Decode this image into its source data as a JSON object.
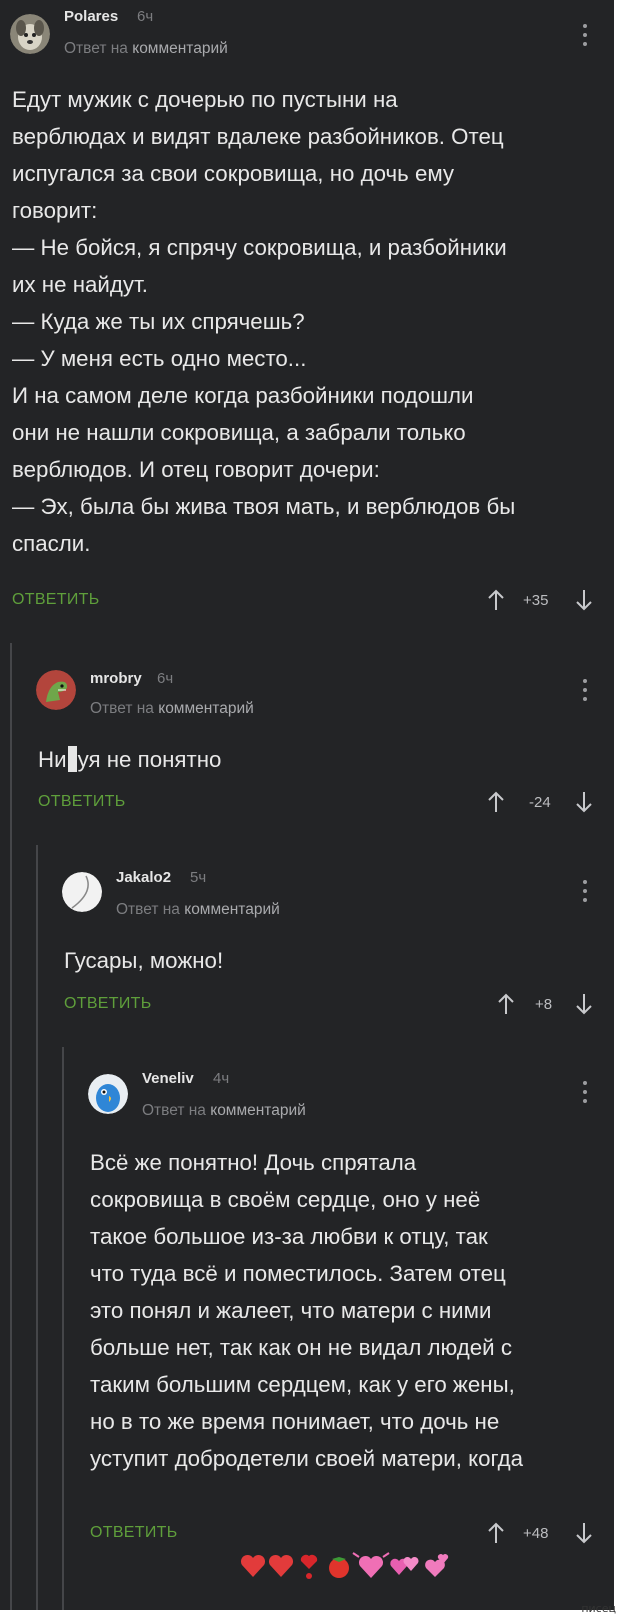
{
  "colors": {
    "background": "#232426",
    "accent_reply": "#5f9f3b",
    "text": "#e8e8e8",
    "muted": "#7c7d80"
  },
  "comments": [
    {
      "username": "Polares",
      "time": "6ч",
      "reply_prefix": "Ответ на",
      "reply_target": "комментарий",
      "avatar_icon": "dog-avatar-icon",
      "text": "Едут мужик с дочерью по пустыни на\nверблюдах и видят вдалеке разбойников. Отец\nиспугался за свои сокровища, но дочь ему\nговорит:\n— Не бойся, я спрячу сокровища, и разбойники\nих не найдут.\n— Куда же ты их спрячешь?\n— У меня есть одно место...\nИ на самом деле когда разбойники подошли\nони не нашли сокровища, а забрали только\nверблюдов. И отец говорит дочери:\n— Эх, была бы жива твоя мать, и верблюдов бы\nспасли.",
      "reply_label": "ОТВЕТИТЬ",
      "rating": "+35"
    },
    {
      "username": "mrobry",
      "time": "6ч",
      "reply_prefix": "Ответ на",
      "reply_target": "комментарий",
      "avatar_icon": "dinosaur-avatar-icon",
      "text_before": "Ни",
      "text_after": "уя не понятно",
      "reply_label": "ОТВЕТИТЬ",
      "rating": "-24"
    },
    {
      "username": "Jakalo2",
      "time": "5ч",
      "reply_prefix": "Ответ на",
      "reply_target": "комментарий",
      "avatar_icon": "ball-avatar-icon",
      "text": "Гусары, можно!",
      "reply_label": "ОТВЕТИТЬ",
      "rating": "+8"
    },
    {
      "username": "Veneliv",
      "time": "4ч",
      "reply_prefix": "Ответ на",
      "reply_target": "комментарий",
      "avatar_icon": "parrot-avatar-icon",
      "text": "Всё же понятно! Дочь спрятала\nсокровища в своём сердце, оно у неё\nтакое большое из-за любви к отцу, так\nчто туда всё и поместилось. Затем отец\nэто понял и жалеет, что матери с ними\nбольше нет, так как он не видал людей с\nтаким большим сердцем, как у его жены,\nно в то же время понимает, что дочь не\nуступит добродетели своей матери, когда\nона вырастет. ",
      "emoji_icon": "hearts-tomato-emoji-icon",
      "reply_label": "ОТВЕТИТЬ",
      "rating": "+48"
    }
  ],
  "watermark": "писец"
}
